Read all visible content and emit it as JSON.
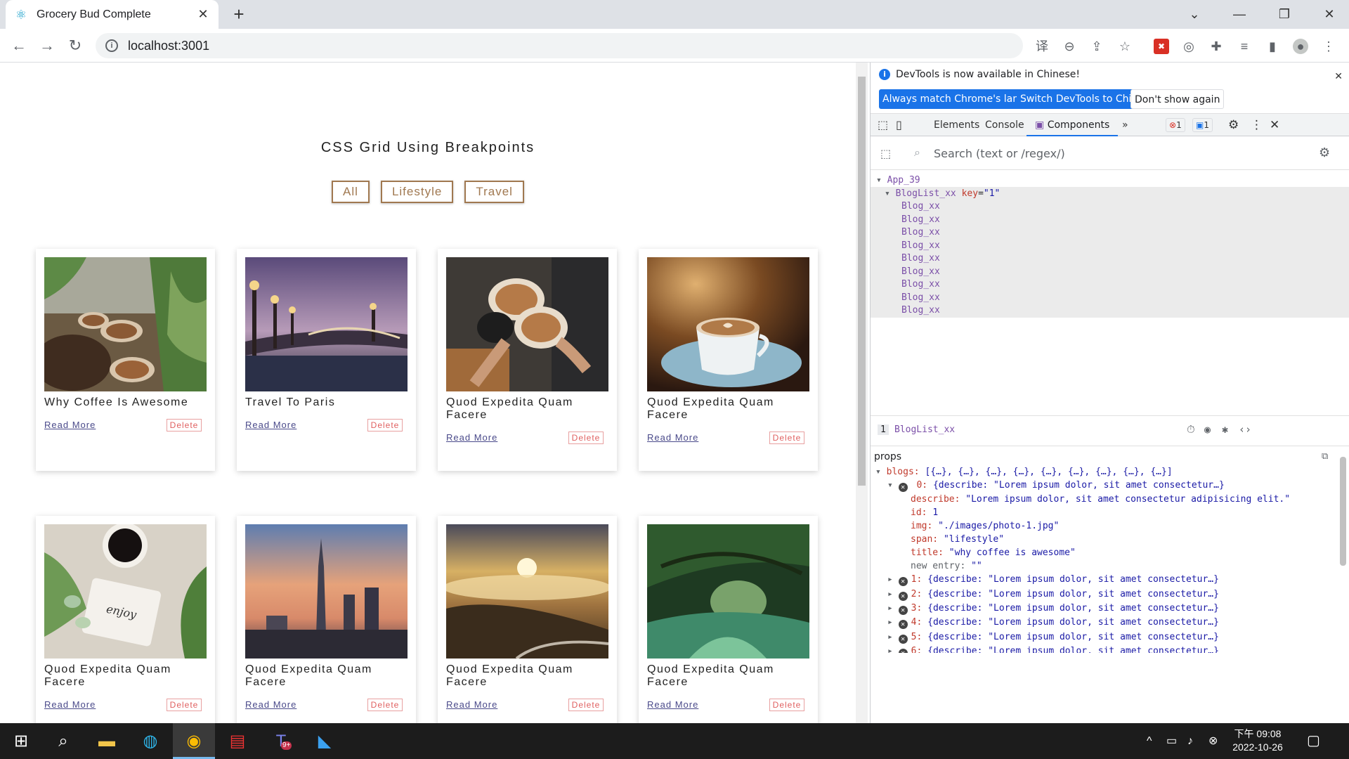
{
  "browser": {
    "tab_title": "Grocery Bud Complete",
    "url": "localhost:3001"
  },
  "page": {
    "heading": "CSS Grid Using Breakpoints",
    "filters": [
      "All",
      "Lifestyle",
      "Travel"
    ],
    "read_more_label": "Read More",
    "delete_label": "Delete",
    "cards": [
      {
        "title": "Why Coffee Is Awesome",
        "image": "coffee-cups-plants"
      },
      {
        "title": "Travel To Paris",
        "image": "paris-bridge-dusk"
      },
      {
        "title": "Quod Expedita Quam Facere",
        "image": "coffee-toast-hands"
      },
      {
        "title": "Quod Expedita Quam Facere",
        "image": "latte-heart-cup"
      },
      {
        "title": "Quod Expedita Quam Facere",
        "image": "coffee-enjoy-little-things"
      },
      {
        "title": "Quod Expedita Quam Facere",
        "image": "taipei-101-sunset"
      },
      {
        "title": "Quod Expedita Quam Facere",
        "image": "mountain-sunrise-clouds"
      },
      {
        "title": "Quod Expedita Quam Facere",
        "image": "green-tunnel-river"
      }
    ]
  },
  "devtools": {
    "info_message": "DevTools is now available in Chinese!",
    "btn_match": "Always match Chrome's language",
    "btn_switch": "Switch DevTools to Chinese",
    "btn_dont_show": "Don't show again",
    "tabs": [
      "Elements",
      "Console",
      "Components"
    ],
    "active_tab": "Components",
    "error_count": "1",
    "message_count": "1",
    "search_placeholder": "Search (text or /regex/)",
    "tree": {
      "root": "App_39",
      "list": "BlogList_xx",
      "list_key_attr": "key",
      "list_key_val": "\"1\"",
      "children": [
        "Blog_xx",
        "Blog_xx",
        "Blog_xx",
        "Blog_xx",
        "Blog_xx",
        "Blog_xx",
        "Blog_xx",
        "Blog_xx",
        "Blog_xx"
      ]
    },
    "selected": {
      "index": "1",
      "name": "BlogList_xx"
    },
    "props": {
      "heading": "props",
      "blogs_key": "blogs:",
      "blogs_summary": "[{…}, {…}, {…}, {…}, {…}, {…}, {…}, {…}, {…}]",
      "item0_key": "0:",
      "item0_summary": "{describe: \"Lorem ipsum dolor, sit amet consectetur…}",
      "fields": [
        {
          "key": "describe:",
          "value": "\"Lorem ipsum dolor, sit amet consectetur adipisicing elit.\""
        },
        {
          "key": "id:",
          "value": "1"
        },
        {
          "key": "img:",
          "value": "\"./images/photo-1.jpg\""
        },
        {
          "key": "span:",
          "value": "\"lifestyle\""
        },
        {
          "key": "title:",
          "value": "\"why coffee is awesome\""
        }
      ],
      "new_entry_key": "new entry:",
      "new_entry_value": "\"\"",
      "collapsed": [
        {
          "key": "1:",
          "summary": "{describe: \"Lorem ipsum dolor, sit amet consectetur…}"
        },
        {
          "key": "2:",
          "summary": "{describe: \"Lorem ipsum dolor, sit amet consectetur…}"
        },
        {
          "key": "3:",
          "summary": "{describe: \"Lorem ipsum dolor, sit amet consectetur…}"
        },
        {
          "key": "4:",
          "summary": "{describe: \"Lorem ipsum dolor, sit amet consectetur…}"
        },
        {
          "key": "5:",
          "summary": "{describe: \"Lorem ipsum dolor, sit amet consectetur…}"
        },
        {
          "key": "6:",
          "summary": "{describe: \"Lorem ipsum dolor, sit amet consectetur…}"
        }
      ]
    }
  },
  "taskbar": {
    "time": "下午 09:08",
    "date": "2022-10-26",
    "teams_badge": "9+"
  },
  "colors": {
    "accent": "#1a73e8",
    "filter_border": "#a07850",
    "delete_red": "#e06060"
  }
}
